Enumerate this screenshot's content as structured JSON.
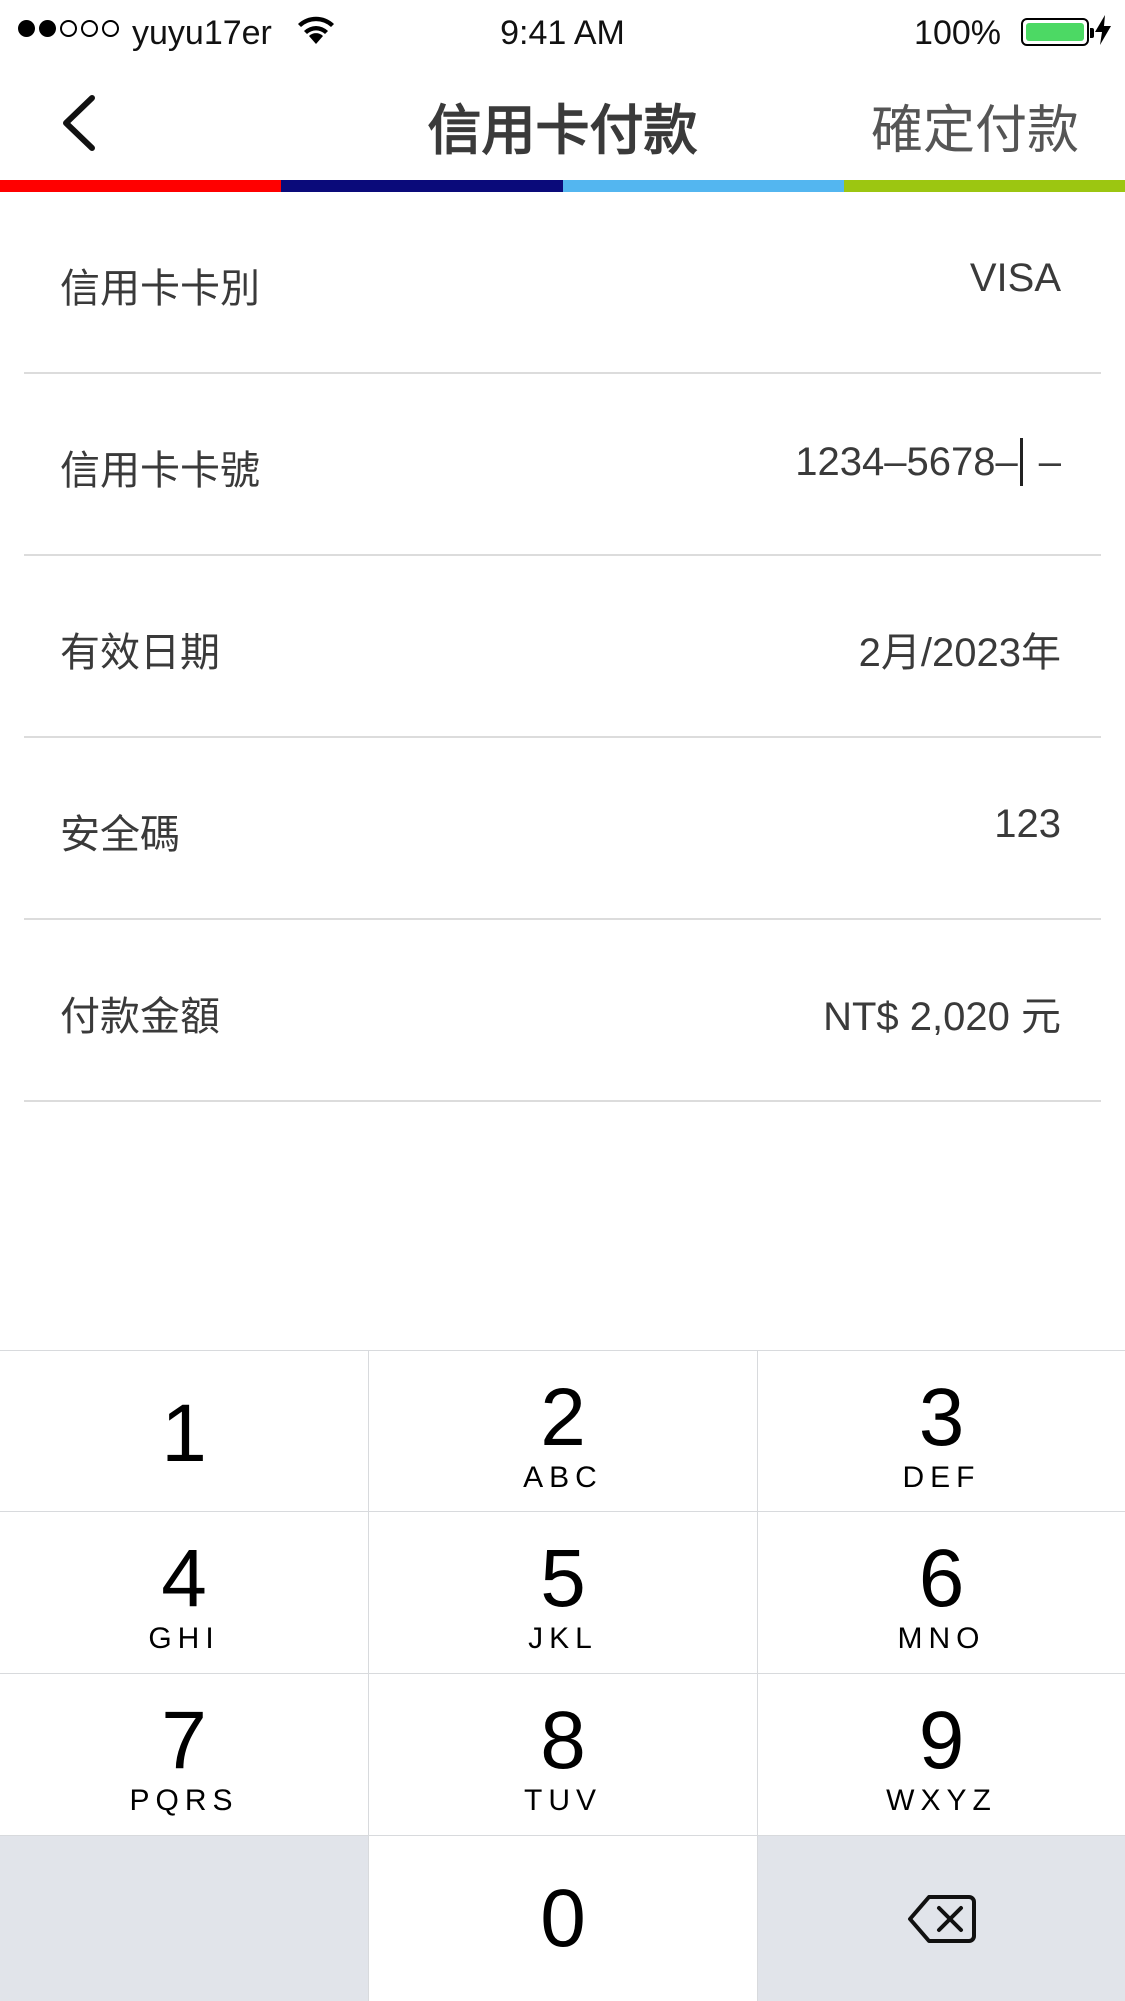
{
  "status_bar": {
    "carrier": "yuyu17er",
    "time": "9:41 AM",
    "battery": "100%"
  },
  "nav": {
    "title": "信用卡付款",
    "confirm": "確定付款"
  },
  "colors": {
    "stripe": [
      "#ff0000",
      "#0a0a7a",
      "#53b6f0",
      "#9cc611"
    ],
    "battery": "#4cd964",
    "gray_key": "#e1e4ea"
  },
  "form": {
    "rows": [
      {
        "label": "信用卡卡別",
        "value": "VISA"
      },
      {
        "label": "信用卡卡號",
        "value": "1234–5678–",
        "value_tail": "–"
      },
      {
        "label": "有效日期",
        "value": "2月/2023年"
      },
      {
        "label": "安全碼",
        "value": "123"
      },
      {
        "label": "付款金額",
        "value": "NT$ 2,020 元"
      }
    ]
  },
  "keypad": {
    "keys": [
      {
        "digit": "1",
        "letters": ""
      },
      {
        "digit": "2",
        "letters": "ABC"
      },
      {
        "digit": "3",
        "letters": "DEF"
      },
      {
        "digit": "4",
        "letters": "GHI"
      },
      {
        "digit": "5",
        "letters": "JKL"
      },
      {
        "digit": "6",
        "letters": "MNO"
      },
      {
        "digit": "7",
        "letters": "PQRS"
      },
      {
        "digit": "8",
        "letters": "TUV"
      },
      {
        "digit": "9",
        "letters": "WXYZ"
      },
      {
        "digit": "0",
        "letters": ""
      }
    ],
    "icons": {
      "delete": "backspace-icon"
    }
  }
}
